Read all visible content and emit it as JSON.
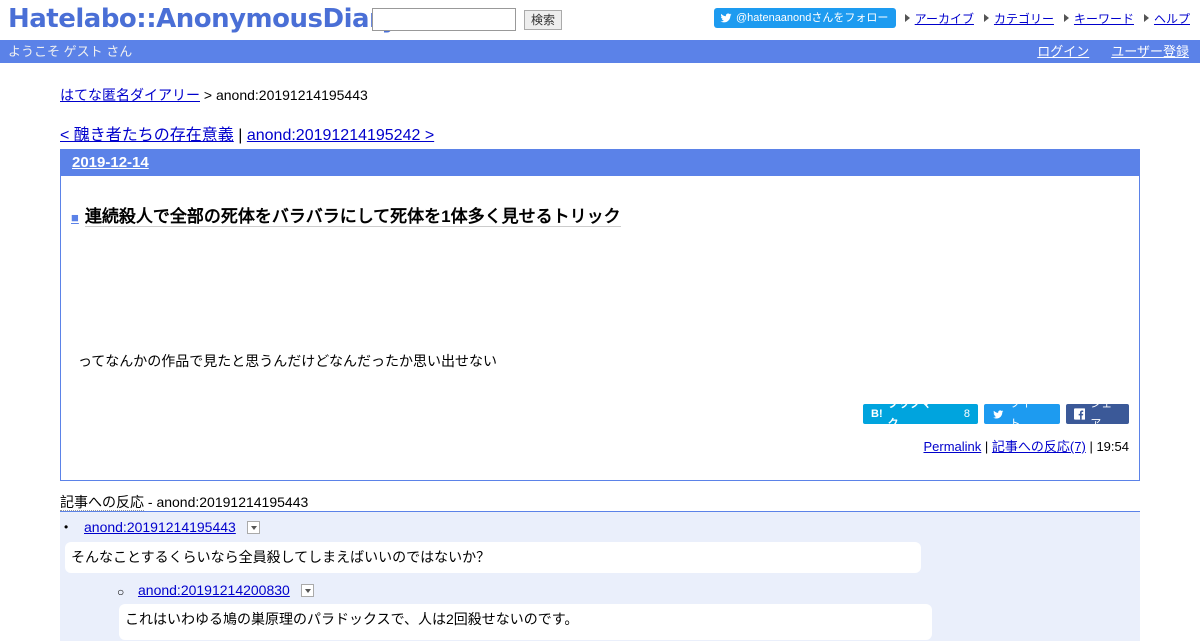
{
  "header": {
    "logo": "Hatelabo::AnonymousDiary",
    "search_value": "",
    "search_button": "検索",
    "twitter_follow": "@hatenaanondさんをフォロー",
    "nav": [
      "アーカイブ",
      "カテゴリー",
      "キーワード",
      "ヘルプ"
    ]
  },
  "welcome": {
    "text": "ようこそ ゲスト さん",
    "login": "ログイン",
    "register": "ユーザー登録"
  },
  "breadcrumb": {
    "home": "はてな匿名ダイアリー",
    "sep": ">",
    "current": "anond:20191214195443"
  },
  "pager": {
    "prev": "< 醜き者たちの存在意義",
    "sep": "|",
    "next": "anond:20191214195242 >"
  },
  "entry": {
    "date": "2019-12-14",
    "square": "■",
    "title": "連続殺人で全部の死体をバラバラにして死体を1体多く見せるトリック",
    "body": "ってなんかの作品で見たと思うんだけどなんだったか思い出せない",
    "share": {
      "hatena_label": "ブックマーク",
      "hatena_logo": "B!",
      "hatena_count": "8",
      "tweet_label": "ツイート",
      "fb_label": "シェア"
    },
    "meta": {
      "permalink": "Permalink",
      "sep1": "|",
      "reactions_link": "記事への反応(7)",
      "sep2": "|",
      "time": "19:54"
    }
  },
  "reactions": {
    "title_prefix": "記事への反応",
    "title_suffix": " - anond:20191214195443",
    "items": [
      {
        "bullet": "•",
        "link": "anond:20191214195443",
        "text": "そんなことするくらいなら全員殺してしまえばいいのではないか？"
      },
      {
        "bullet": "○",
        "link": "anond:20191214200830",
        "text": "これはいわゆる鳩の巣原理のパラドックスで、人は2回殺せないのです。"
      }
    ]
  }
}
